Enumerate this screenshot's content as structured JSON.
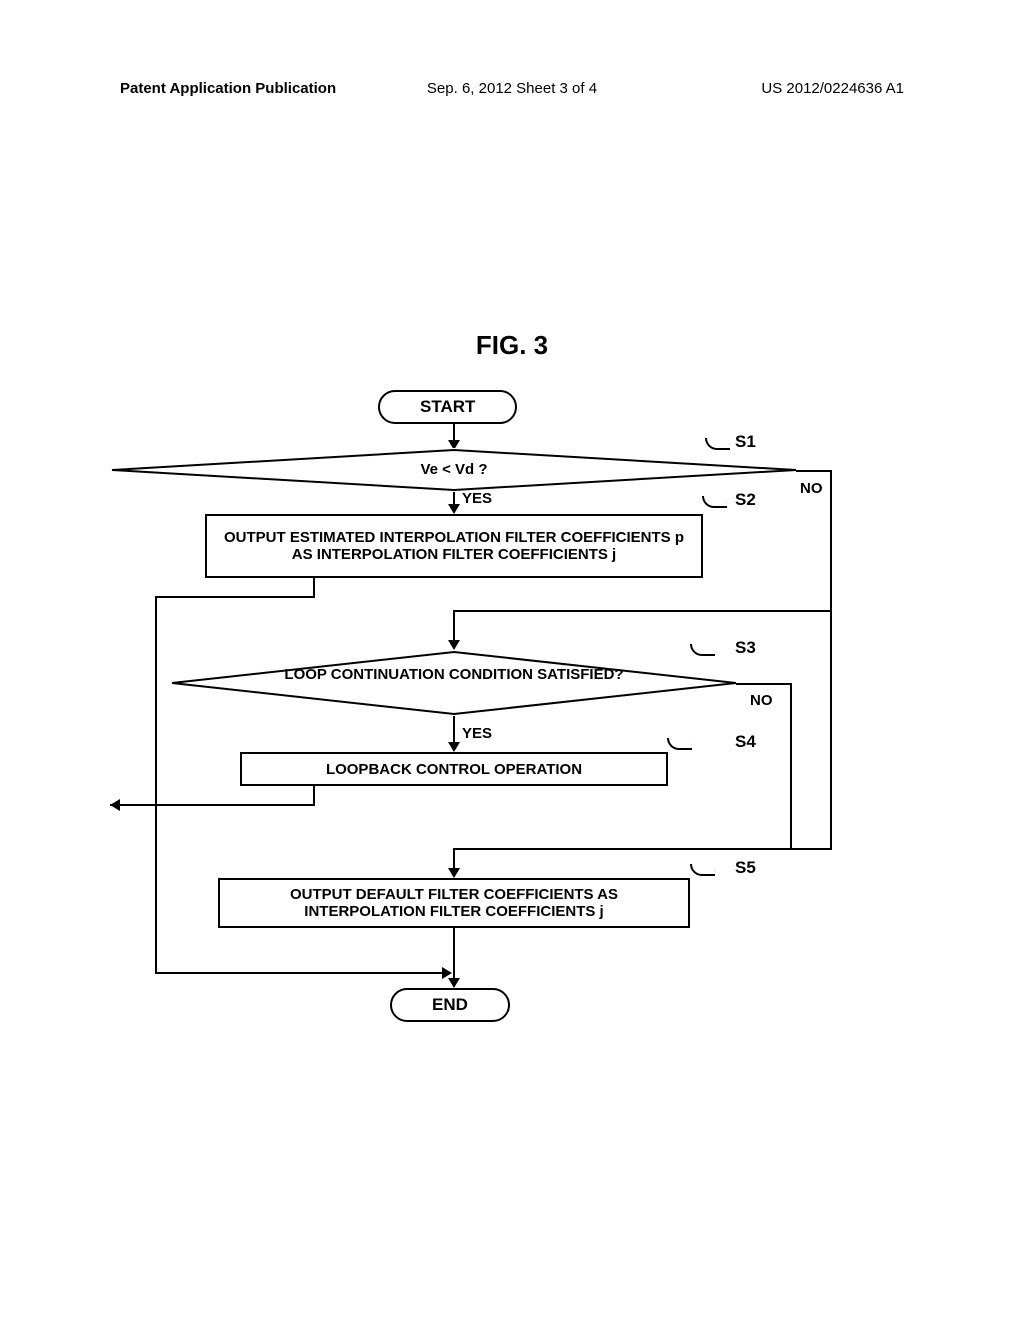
{
  "header": {
    "left": "Patent Application Publication",
    "center": "Sep. 6, 2012  Sheet 3 of 4",
    "right": "US 2012/0224636 A1"
  },
  "figure_title": "FIG. 3",
  "flowchart": {
    "start": "START",
    "end": "END",
    "s1": {
      "label": "S1",
      "text": "Ve < Vd ?",
      "yes": "YES",
      "no": "NO"
    },
    "s2": {
      "label": "S2",
      "text": "OUTPUT ESTIMATED INTERPOLATION FILTER COEFFICIENTS p AS INTERPOLATION FILTER COEFFICIENTS j"
    },
    "s3": {
      "label": "S3",
      "text": "LOOP CONTINUATION CONDITION SATISFIED?",
      "yes": "YES",
      "no": "NO"
    },
    "s4": {
      "label": "S4",
      "text": "LOOPBACK CONTROL OPERATION"
    },
    "s5": {
      "label": "S5",
      "text": "OUTPUT DEFAULT FILTER COEFFICIENTS AS INTERPOLATION FILTER COEFFICIENTS j"
    }
  }
}
